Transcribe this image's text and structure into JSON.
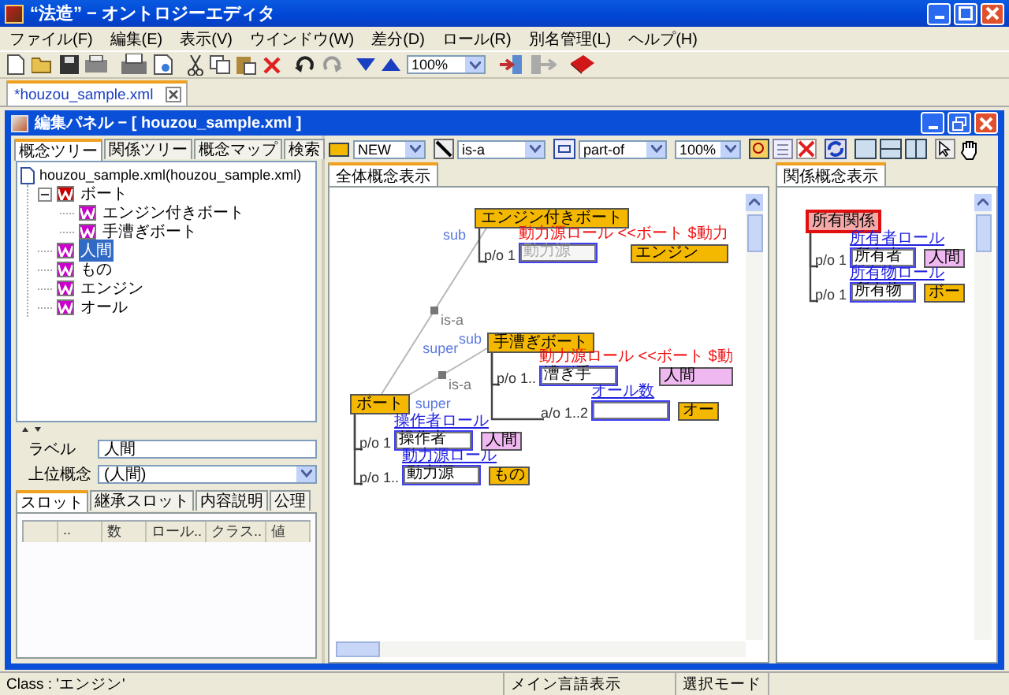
{
  "window": {
    "title": "“法造” − オントロジーエディタ"
  },
  "menu": [
    "ファイル(F)",
    "編集(E)",
    "表示(V)",
    "ウインドウ(W)",
    "差分(D)",
    "ロール(R)",
    "別名管理(L)",
    "ヘルプ(H)"
  ],
  "toolbar": {
    "zoom": "100%"
  },
  "document_tabs": [
    {
      "label": "*houzou_sample.xml",
      "selected": true
    }
  ],
  "panel": {
    "title": "編集パネル − [ houzou_sample.xml ]"
  },
  "left_tabs": [
    {
      "label": "概念ツリー",
      "selected": true
    },
    {
      "label": "関係ツリー",
      "selected": false
    },
    {
      "label": "概念マップ",
      "selected": false
    },
    {
      "label": "検索",
      "selected": false
    }
  ],
  "tree": {
    "root": "houzou_sample.xml(houzou_sample.xml)",
    "children": [
      {
        "label": "ボート",
        "color": "#cc0000",
        "selected": false,
        "expanded": true,
        "children": [
          {
            "label": "エンジン付きボート",
            "color": "#cc00cc",
            "selected": false
          },
          {
            "label": "手漕ぎボート",
            "color": "#cc00cc",
            "selected": false
          }
        ]
      },
      {
        "label": "人間",
        "color": "#cc00cc",
        "selected": true
      },
      {
        "label": "もの",
        "color": "#cc00cc",
        "selected": false
      },
      {
        "label": "エンジン",
        "color": "#cc00cc",
        "selected": false
      },
      {
        "label": "オール",
        "color": "#cc00cc",
        "selected": false
      }
    ]
  },
  "form": {
    "label_caption": "ラベル",
    "label_value": "人間",
    "super_caption": "上位概念",
    "super_value": "(人間)"
  },
  "slot_tabs": [
    {
      "label": "スロット",
      "selected": true
    },
    {
      "label": "継承スロット",
      "selected": false
    },
    {
      "label": "内容説明",
      "selected": false
    },
    {
      "label": "公理",
      "selected": false
    }
  ],
  "slot_columns": [
    "..",
    "数",
    "ロール..",
    "クラス..",
    "値"
  ],
  "map_toolbar": {
    "node_type": "NEW",
    "link_type": "is-a",
    "relation_type": "part-of",
    "zoom": "100%"
  },
  "whole_view": {
    "tab": "全体概念表示",
    "concepts": [
      {
        "label": "エンジン付きボート",
        "slots": [
          {
            "cardinality": "p/o 1",
            "role": "動力源ロール <<ボート $動力",
            "inherited": true,
            "value": "動力源",
            "value_disabled": true,
            "class": "エンジン",
            "color": "#f5b800"
          }
        ]
      },
      {
        "label": "手漕ぎボート",
        "slots": [
          {
            "cardinality": "p/o 1..",
            "role": "動力源ロール <<ボート $動",
            "inherited": true,
            "value": "漕ぎ手",
            "value_disabled": false,
            "class": "人間",
            "color": "#f0b8f0"
          },
          {
            "cardinality": "a/o 1..2",
            "role": "オール数",
            "inherited": false,
            "class": "オー",
            "color": "#f5b800"
          }
        ]
      },
      {
        "label": "ボート",
        "slots": [
          {
            "cardinality": "p/o 1",
            "role": "操作者ロール",
            "inherited": false,
            "value": "操作者",
            "value_disabled": false,
            "class": "人間",
            "color": "#f0b8f0"
          },
          {
            "cardinality": "p/o 1..",
            "role": "動力源ロール",
            "inherited": false,
            "value": "動力源",
            "value_disabled": false,
            "class": "もの",
            "color": "#f5b800"
          }
        ]
      }
    ],
    "isa_links": [
      {
        "sub_label": "sub",
        "super_label": "super",
        "marker": "is-a"
      },
      {
        "sub_label": "sub",
        "super_label": "super",
        "marker": "is-a"
      }
    ]
  },
  "relation_view": {
    "tab": "関係概念表示",
    "relation": {
      "label": "所有関係",
      "slots": [
        {
          "cardinality": "p/o 1",
          "role": "所有者ロール",
          "inherited": false,
          "value": "所有者",
          "value_disabled": false,
          "class": "人間",
          "color": "#f0b8f0"
        },
        {
          "cardinality": "p/o 1",
          "role": "所有物ロール",
          "inherited": false,
          "value": "所有物",
          "value_disabled": false,
          "class": "ボー",
          "color": "#f5b800"
        }
      ]
    }
  },
  "status_bar": [
    "Class : 'エンジン'",
    "メイン言語表示",
    "選択モード"
  ]
}
